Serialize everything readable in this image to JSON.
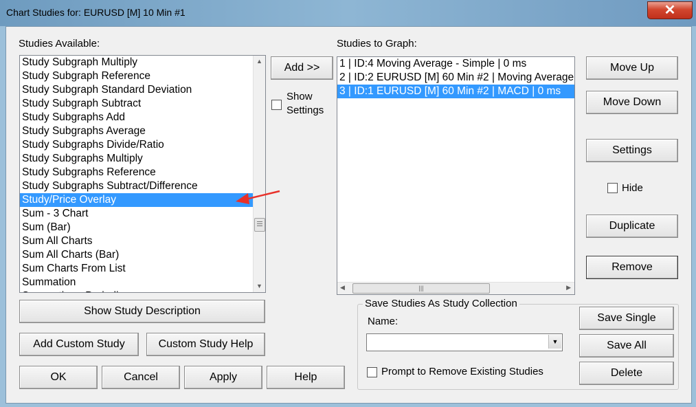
{
  "window": {
    "title": "Chart Studies for: EURUSD [M]  10 Min   #1",
    "close_glyph": "✕"
  },
  "available": {
    "label": "Studies Available:",
    "items": [
      "Study Subgraph Multiply",
      "Study Subgraph Reference",
      "Study Subgraph Standard Deviation",
      "Study Subgraph Subtract",
      "Study Subgraphs Add",
      "Study Subgraphs Average",
      "Study Subgraphs Divide/Ratio",
      "Study Subgraphs Multiply",
      "Study Subgraphs Reference",
      "Study Subgraphs Subtract/Difference",
      "Study/Price Overlay",
      "Sum - 3 Chart",
      "Sum (Bar)",
      "Sum All Charts",
      "Sum All Charts (Bar)",
      "Sum Charts From List",
      "Summation",
      "Summation - Periodic"
    ],
    "selected_index": 10
  },
  "add_button": "Add >>",
  "show_settings": {
    "line1": "Show",
    "line2": "Settings"
  },
  "graph": {
    "label": "Studies to Graph:",
    "items": [
      "1 | ID:4  Moving Average - Simple | 0 ms",
      "2 | ID:2  EURUSD [M]  60 Min   #2 | Moving Average",
      "3 | ID:1  EURUSD [M]  60 Min   #2 | MACD | 0 ms"
    ],
    "selected_index": 2
  },
  "right_buttons": {
    "move_up": "Move Up",
    "move_down": "Move Down",
    "settings": "Settings",
    "hide": "Hide",
    "duplicate": "Duplicate",
    "remove": "Remove"
  },
  "bottom_left": {
    "show_description": "Show Study Description",
    "add_custom": "Add Custom Study",
    "custom_help": "Custom Study Help",
    "ok": "OK",
    "cancel": "Cancel",
    "apply": "Apply",
    "help": "Help"
  },
  "collection": {
    "group_label": "Save Studies As Study Collection",
    "name_label": "Name:",
    "name_value": "",
    "prompt_remove": "Prompt to Remove Existing Studies",
    "save_single": "Save Single",
    "save_all": "Save All",
    "delete": "Delete"
  },
  "colors": {
    "selection": "#3399ff",
    "annotation_arrow": "#e8312a"
  }
}
